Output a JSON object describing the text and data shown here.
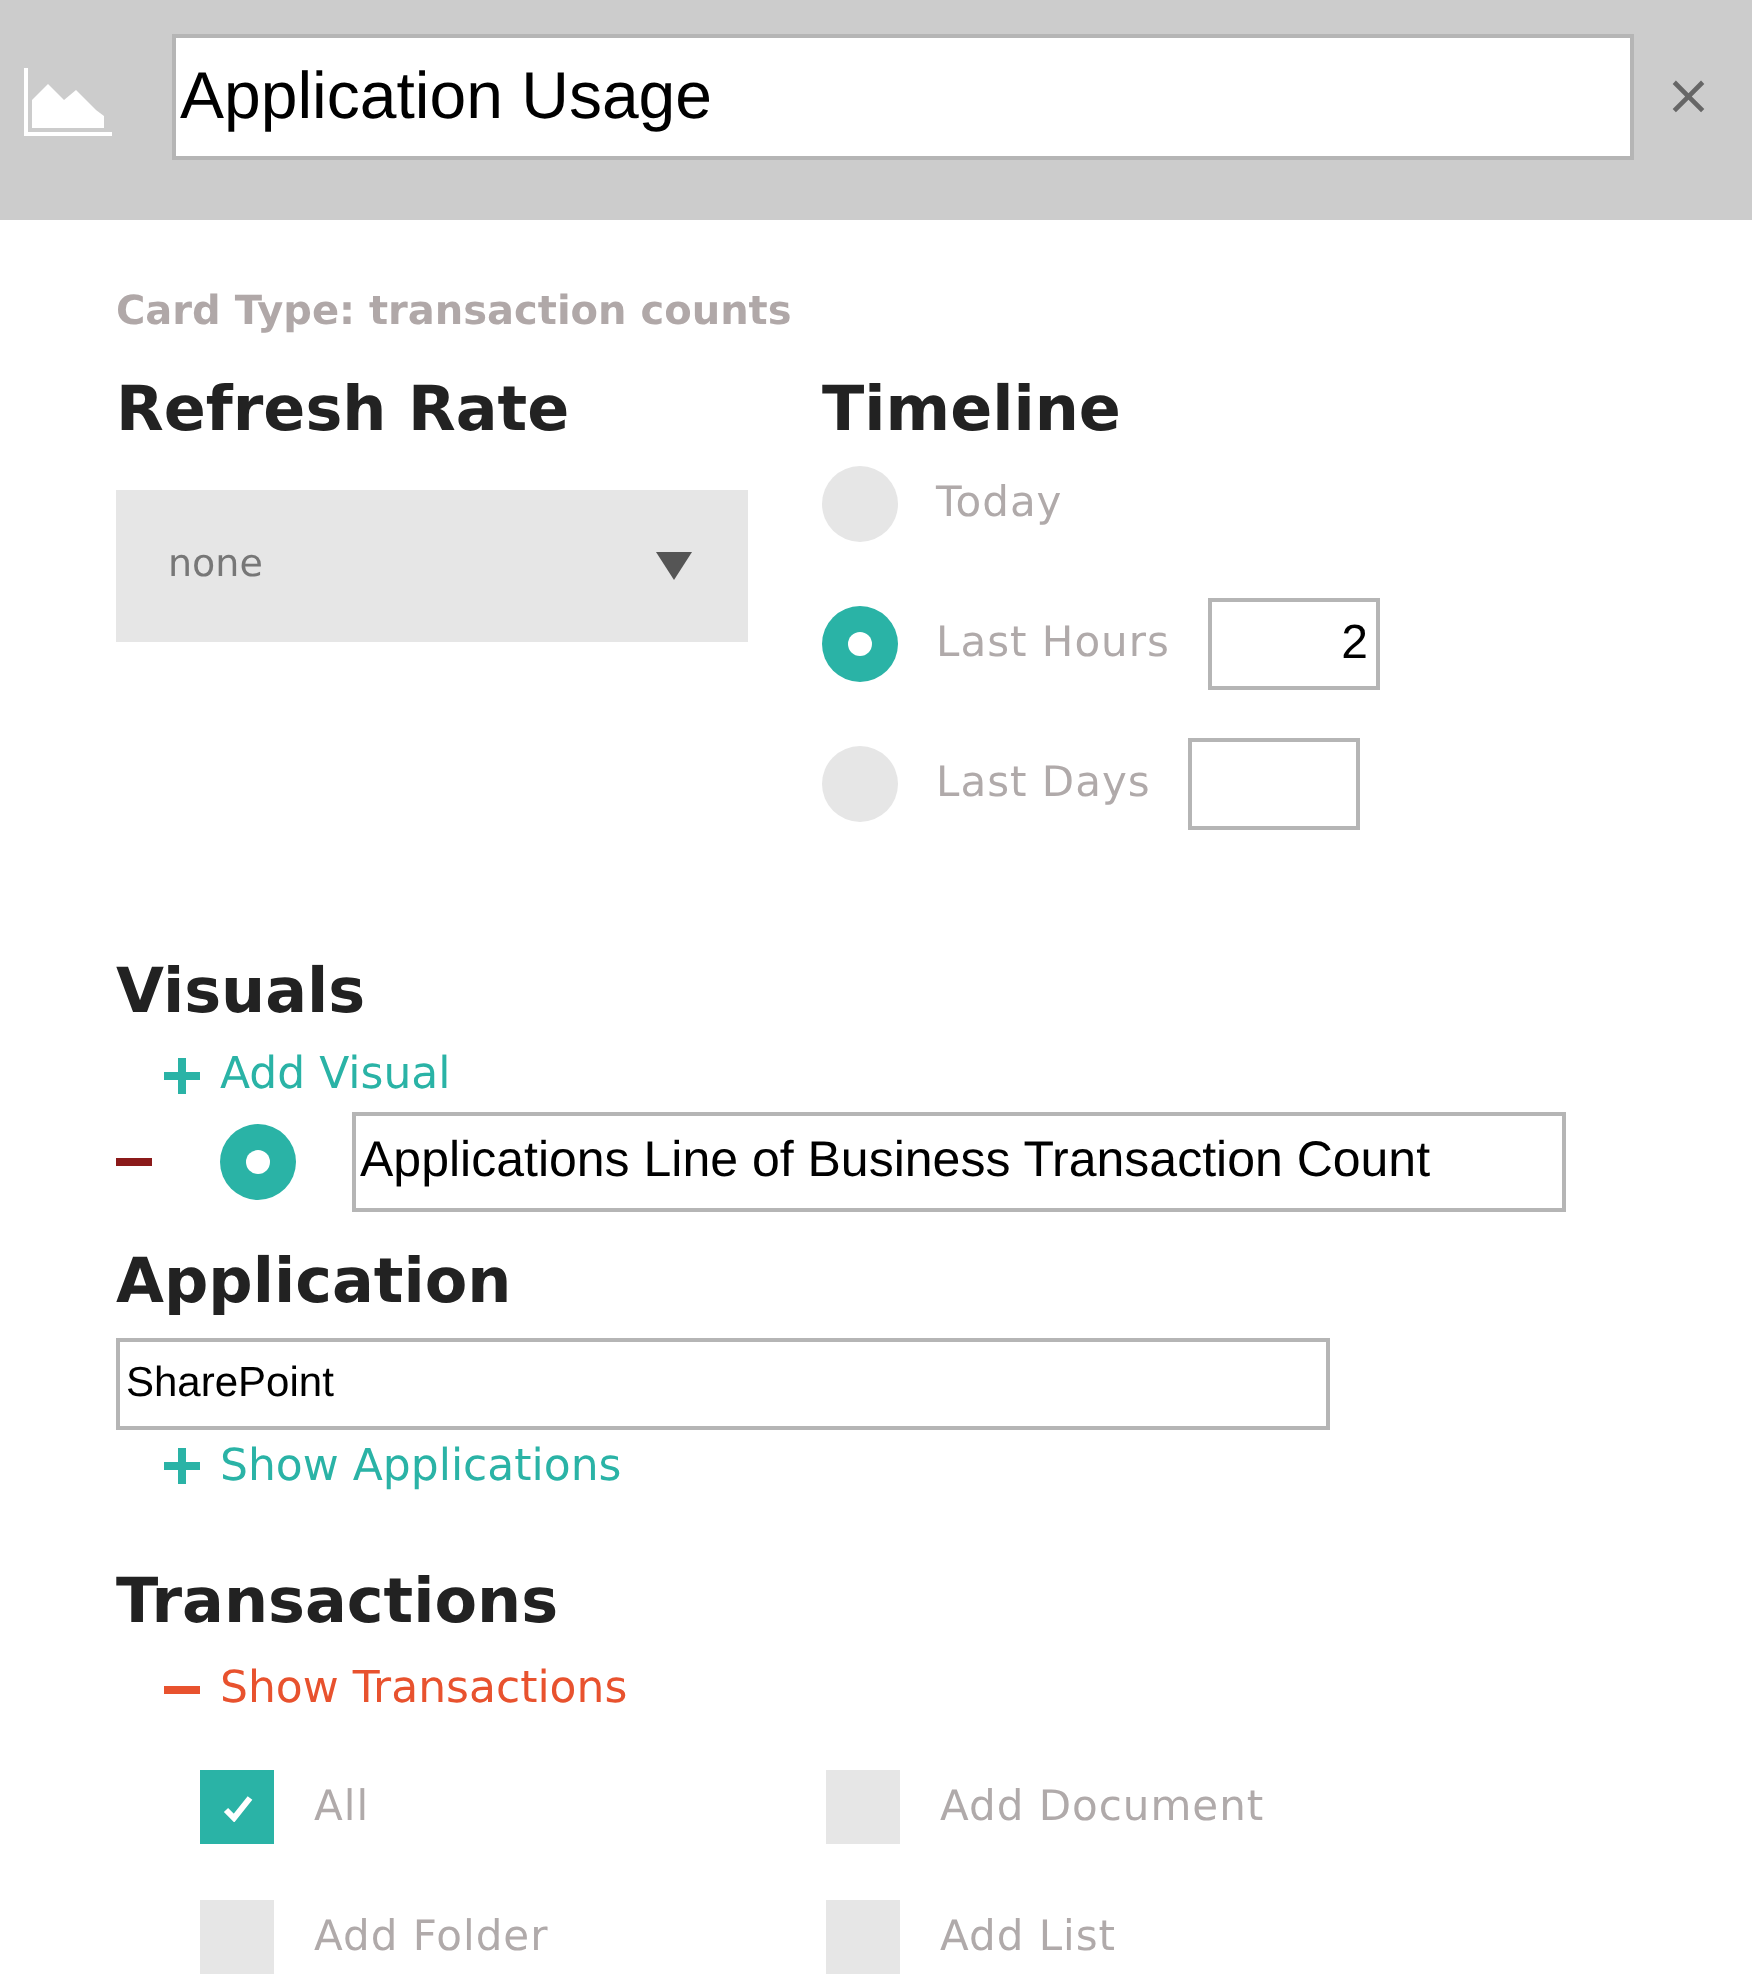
{
  "header": {
    "title": "Application Usage",
    "close": "×"
  },
  "card_type": "Card Type: transaction counts",
  "refresh_rate": {
    "heading": "Refresh Rate",
    "value": "none"
  },
  "timeline": {
    "heading": "Timeline",
    "options": [
      {
        "kind": "plain",
        "label": "Today",
        "selected": false
      },
      {
        "kind": "field",
        "label": "Last Hours",
        "selected": true,
        "value": "2"
      },
      {
        "kind": "field",
        "label": "Last Days",
        "selected": false
      }
    ]
  },
  "visuals": {
    "heading": "Visuals",
    "add": "Add Visual",
    "items": [
      {
        "name": "Applications Line of Business Transaction Count",
        "selected": true
      }
    ]
  },
  "application": {
    "heading": "Application",
    "value": "SharePoint",
    "toggle": {
      "label": "Show Applications",
      "expanded": false
    }
  },
  "transactions": {
    "heading": "Transactions",
    "toggle": {
      "label": "Show Transactions",
      "expanded": true
    },
    "items": [
      {
        "label": "All",
        "checked": true
      },
      {
        "label": "Add Document",
        "checked": false
      },
      {
        "label": "Add Folder",
        "checked": false
      },
      {
        "label": "Add List",
        "checked": false
      }
    ]
  }
}
